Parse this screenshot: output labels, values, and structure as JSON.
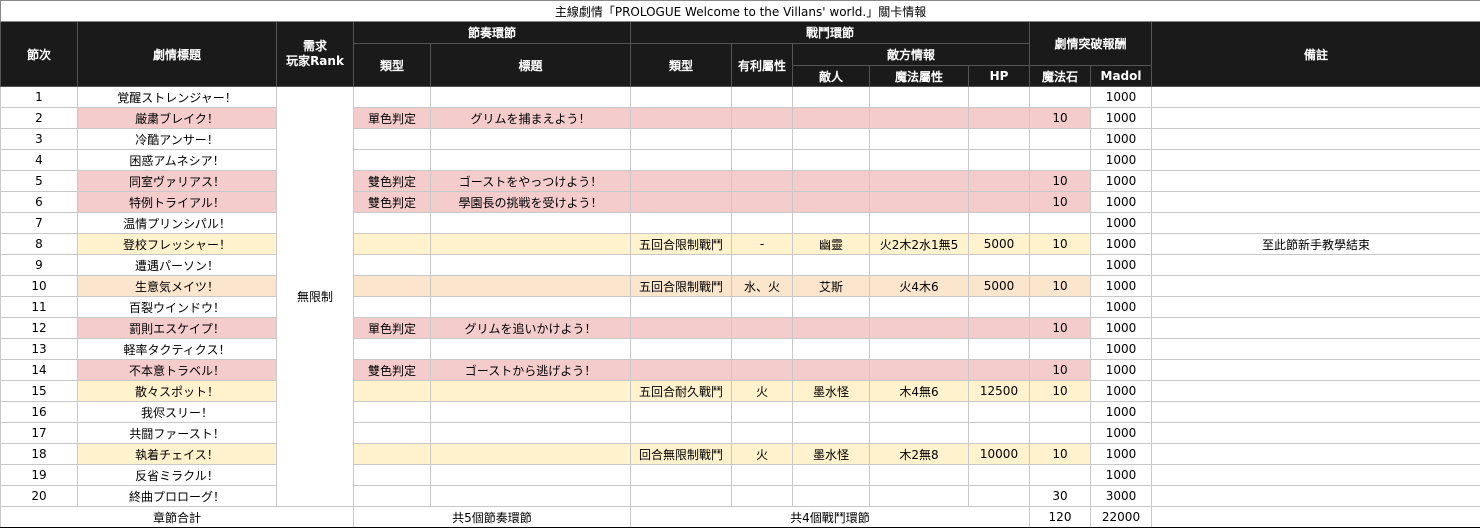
{
  "title": "主線劇情「PROLOGUE Welcome to the Villans' world.」關卡情報",
  "headers": {
    "chapter": "節次",
    "story_title": "劇情標題",
    "req_rank": "需求\n玩家Rank",
    "rhythm": "節奏環節",
    "rhythm_type": "類型",
    "rhythm_title": "標題",
    "battle": "戰鬥環節",
    "battle_type": "類型",
    "advantage": "有利屬性",
    "enemy_info": "敵方情報",
    "enemy": "敵人",
    "magic_attr": "魔法屬性",
    "hp": "HP",
    "reward": "劇情突破報酬",
    "magic_stone": "魔法石",
    "madol": "Madol",
    "notes": "備註"
  },
  "rank_value": "無限制",
  "rows": [
    {
      "n": "1",
      "t": "覚醒ストレンジャー！",
      "rt": "",
      "rtt": "",
      "bt": "",
      "adv": "",
      "en": "",
      "ma": "",
      "hp": "",
      "ms": "",
      "md": "1000",
      "note": "",
      "hl": ""
    },
    {
      "n": "2",
      "t": "厳粛ブレイク！",
      "rt": "單色判定",
      "rtt": "グリムを捕まえよう！",
      "bt": "",
      "adv": "",
      "en": "",
      "ma": "",
      "hp": "",
      "ms": "10",
      "md": "1000",
      "note": "",
      "hl": "pink"
    },
    {
      "n": "3",
      "t": "冷酷アンサー！",
      "rt": "",
      "rtt": "",
      "bt": "",
      "adv": "",
      "en": "",
      "ma": "",
      "hp": "",
      "ms": "",
      "md": "1000",
      "note": "",
      "hl": ""
    },
    {
      "n": "4",
      "t": "困惑アムネシア！",
      "rt": "",
      "rtt": "",
      "bt": "",
      "adv": "",
      "en": "",
      "ma": "",
      "hp": "",
      "ms": "",
      "md": "1000",
      "note": "",
      "hl": ""
    },
    {
      "n": "5",
      "t": "同室ヴァリアス！",
      "rt": "雙色判定",
      "rtt": "ゴーストをやっつけよう！",
      "bt": "",
      "adv": "",
      "en": "",
      "ma": "",
      "hp": "",
      "ms": "10",
      "md": "1000",
      "note": "",
      "hl": "pink"
    },
    {
      "n": "6",
      "t": "特例トライアル！",
      "rt": "雙色判定",
      "rtt": "學園長の挑戦を受けよう！",
      "bt": "",
      "adv": "",
      "en": "",
      "ma": "",
      "hp": "",
      "ms": "10",
      "md": "1000",
      "note": "",
      "hl": "pink"
    },
    {
      "n": "7",
      "t": "温情プリンシパル！",
      "rt": "",
      "rtt": "",
      "bt": "",
      "adv": "",
      "en": "",
      "ma": "",
      "hp": "",
      "ms": "",
      "md": "1000",
      "note": "",
      "hl": ""
    },
    {
      "n": "8",
      "t": "登校フレッシャー！",
      "rt": "",
      "rtt": "",
      "bt": "五回合限制戰鬥",
      "adv": "-",
      "en": "幽靈",
      "ma": "火2木2水1無5",
      "hp": "5000",
      "ms": "10",
      "md": "1000",
      "note": "至此節新手教學結束",
      "hl": "yellow"
    },
    {
      "n": "9",
      "t": "遭遇パーソン！",
      "rt": "",
      "rtt": "",
      "bt": "",
      "adv": "",
      "en": "",
      "ma": "",
      "hp": "",
      "ms": "",
      "md": "1000",
      "note": "",
      "hl": ""
    },
    {
      "n": "10",
      "t": "生意気メイツ！",
      "rt": "",
      "rtt": "",
      "bt": "五回合限制戰鬥",
      "adv": "水、火",
      "en": "艾斯",
      "ma": "火4木6",
      "hp": "5000",
      "ms": "10",
      "md": "1000",
      "note": "",
      "hl": "orange"
    },
    {
      "n": "11",
      "t": "百裂ウインドウ！",
      "rt": "",
      "rtt": "",
      "bt": "",
      "adv": "",
      "en": "",
      "ma": "",
      "hp": "",
      "ms": "",
      "md": "1000",
      "note": "",
      "hl": ""
    },
    {
      "n": "12",
      "t": "罰則エスケイプ！",
      "rt": "單色判定",
      "rtt": "グリムを追いかけよう！",
      "bt": "",
      "adv": "",
      "en": "",
      "ma": "",
      "hp": "",
      "ms": "10",
      "md": "1000",
      "note": "",
      "hl": "pink"
    },
    {
      "n": "13",
      "t": "軽率タクティクス！",
      "rt": "",
      "rtt": "",
      "bt": "",
      "adv": "",
      "en": "",
      "ma": "",
      "hp": "",
      "ms": "",
      "md": "1000",
      "note": "",
      "hl": ""
    },
    {
      "n": "14",
      "t": "不本意トラベル！",
      "rt": "雙色判定",
      "rtt": "ゴーストから逃げよう！",
      "bt": "",
      "adv": "",
      "en": "",
      "ma": "",
      "hp": "",
      "ms": "10",
      "md": "1000",
      "note": "",
      "hl": "pink"
    },
    {
      "n": "15",
      "t": "散々スポット！",
      "rt": "",
      "rtt": "",
      "bt": "五回合耐久戰鬥",
      "adv": "火",
      "en": "墨水怪",
      "ma": "木4無6",
      "hp": "12500",
      "ms": "10",
      "md": "1000",
      "note": "",
      "hl": "yellow"
    },
    {
      "n": "16",
      "t": "我侭スリー！",
      "rt": "",
      "rtt": "",
      "bt": "",
      "adv": "",
      "en": "",
      "ma": "",
      "hp": "",
      "ms": "",
      "md": "1000",
      "note": "",
      "hl": ""
    },
    {
      "n": "17",
      "t": "共闘ファースト！",
      "rt": "",
      "rtt": "",
      "bt": "",
      "adv": "",
      "en": "",
      "ma": "",
      "hp": "",
      "ms": "",
      "md": "1000",
      "note": "",
      "hl": ""
    },
    {
      "n": "18",
      "t": "執着チェイス！",
      "rt": "",
      "rtt": "",
      "bt": "回合無限制戰鬥",
      "adv": "火",
      "en": "墨水怪",
      "ma": "木2無8",
      "hp": "10000",
      "ms": "10",
      "md": "1000",
      "note": "",
      "hl": "yellow"
    },
    {
      "n": "19",
      "t": "反省ミラクル！",
      "rt": "",
      "rtt": "",
      "bt": "",
      "adv": "",
      "en": "",
      "ma": "",
      "hp": "",
      "ms": "",
      "md": "1000",
      "note": "",
      "hl": ""
    },
    {
      "n": "20",
      "t": "終曲プロローグ！",
      "rt": "",
      "rtt": "",
      "bt": "",
      "adv": "",
      "en": "",
      "ma": "",
      "hp": "",
      "ms": "30",
      "md": "3000",
      "note": "",
      "hl": ""
    }
  ],
  "totals": {
    "label": "章節合計",
    "rhythm": "共5個節奏環節",
    "battle": "共4個戰鬥環節",
    "magic_stone": "120",
    "madol": "22000"
  }
}
